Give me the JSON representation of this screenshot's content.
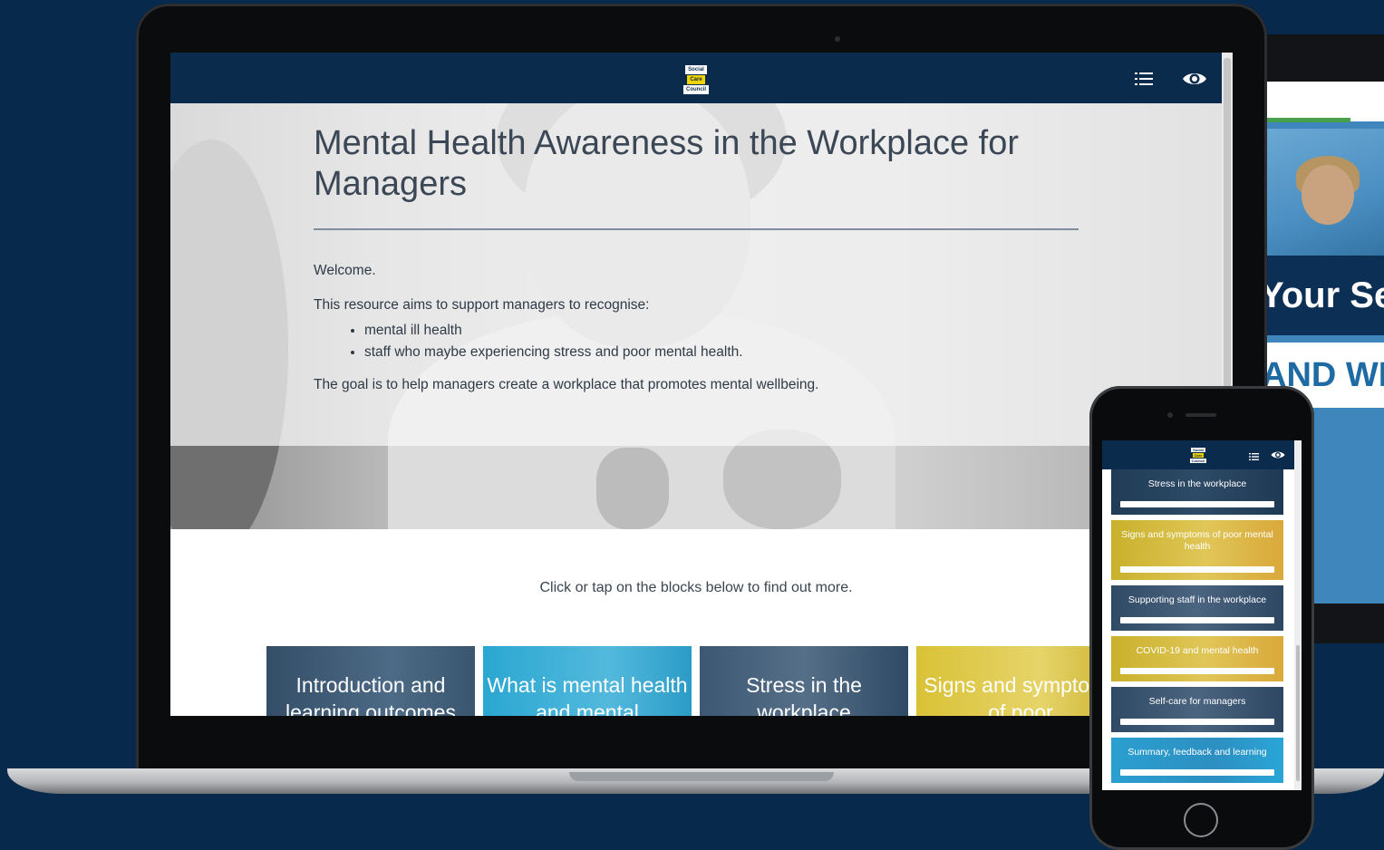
{
  "laptop": {
    "logo": {
      "line1": "Social",
      "line2": "Care",
      "line3": "Council"
    },
    "header_icons": {
      "menu": "list-icon",
      "accessibility": "eye-icon"
    },
    "hero": {
      "title": "Mental Health Awareness in the Workplace for Managers",
      "welcome": "Welcome.",
      "intro": "This resource aims to support managers to recognise:",
      "bullets": [
        "mental ill health",
        "staff who maybe experiencing stress and poor mental health."
      ],
      "goal": "The goal is to help managers create a workplace that promotes mental wellbeing."
    },
    "cta": "Click or tap on the blocks below to find out more.",
    "tiles": [
      {
        "label": "Introduction and learning outcomes",
        "color": "#344e67"
      },
      {
        "label": "What is mental health and mental",
        "color": "#2aa7d2"
      },
      {
        "label": "Stress in the workplace",
        "color": "#3c5873"
      },
      {
        "label": "Signs and symptoms of poor",
        "color": "#d9c236"
      }
    ]
  },
  "phone": {
    "logo": {
      "line1": "Social",
      "line2": "Care",
      "line3": "Council"
    },
    "tiles": [
      {
        "label": "Stress in the workplace"
      },
      {
        "label": "Signs and symptoms of poor mental health"
      },
      {
        "label": "Supporting staff in the workplace"
      },
      {
        "label": "COVID-19 and mental health"
      },
      {
        "label": "Self-care for managers"
      },
      {
        "label": "Summary, feedback and learning"
      }
    ]
  },
  "tablet": {
    "band1": "Your Se",
    "band2": "AND WE"
  },
  "colors": {
    "background": "#06294c",
    "header": "#0b2b4d",
    "logo_yellow": "#f0d200"
  }
}
